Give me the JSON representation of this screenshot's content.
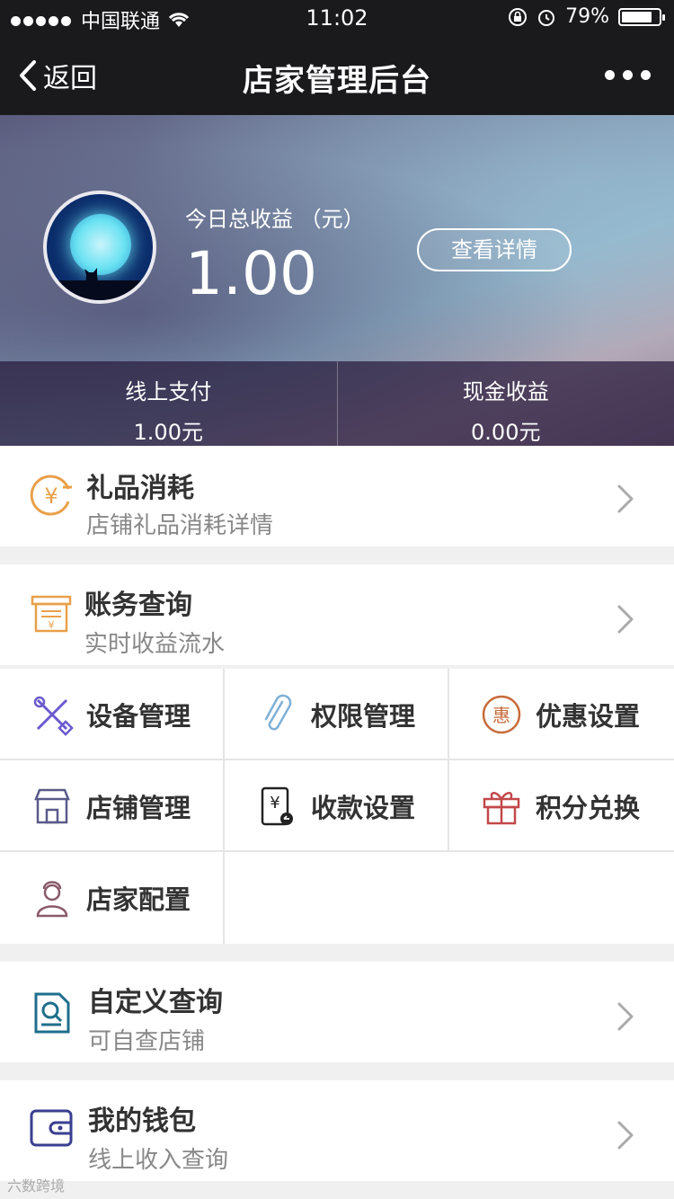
{
  "status": {
    "carrier": "中国联通",
    "time": "11:02",
    "battery": "79%"
  },
  "nav": {
    "back": "返回",
    "title": "店家管理后台"
  },
  "hero": {
    "label": "今日总收益 （元）",
    "amount": "1.00",
    "detail_button": "查看详情",
    "stats": [
      {
        "label": "线上支付",
        "value": "1.00元"
      },
      {
        "label": "现金收益",
        "value": "0.00元"
      }
    ]
  },
  "rows": {
    "gift": {
      "title": "礼品消耗",
      "sub": "店铺礼品消耗详情"
    },
    "account": {
      "title": "账务查询",
      "sub": "实时收益流水"
    },
    "custom": {
      "title": "自定义查询",
      "sub": "可自查店铺"
    },
    "wallet": {
      "title": "我的钱包",
      "sub": "线上收入查询"
    }
  },
  "grid": {
    "device": "设备管理",
    "permission": "权限管理",
    "discount": "优惠设置",
    "shop": "店铺管理",
    "payment": "收款设置",
    "points": "积分兑换",
    "merchant": "店家配置"
  },
  "icons": {
    "discount_char": "惠",
    "yen": "¥"
  },
  "watermark": "六数跨境",
  "colors": {
    "navbar": "#1a1a1d",
    "accent_orange": "#e8a04a",
    "accent_purple": "#6a5acd"
  }
}
